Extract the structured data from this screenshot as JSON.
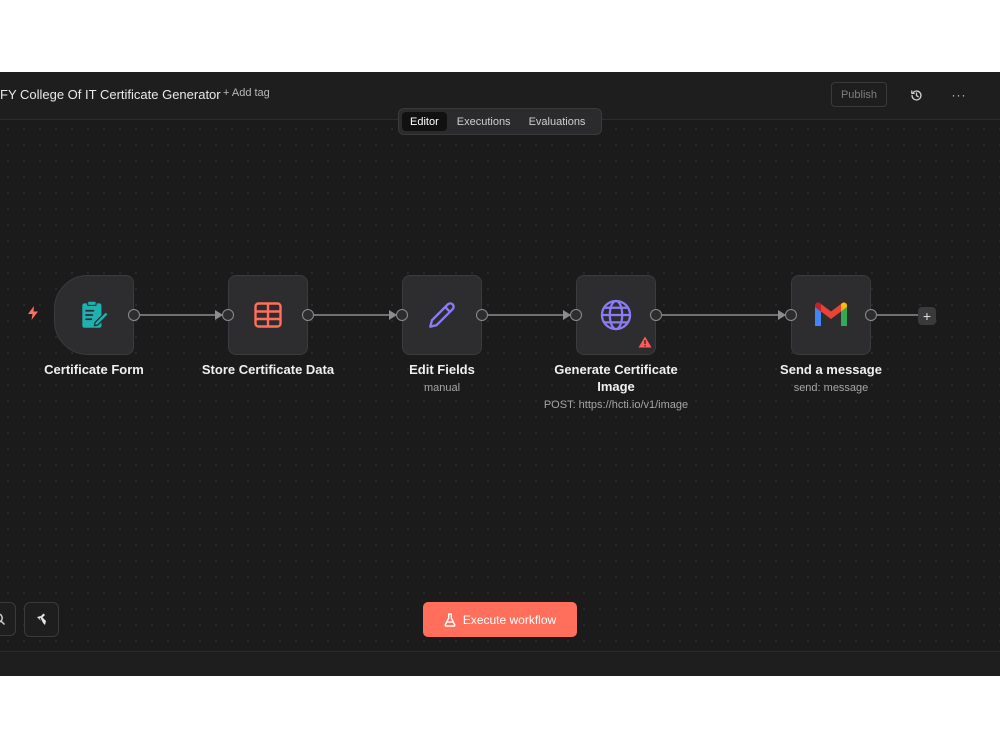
{
  "header": {
    "title": "FY College Of IT Certificate Generator",
    "add_tag": "+ Add tag",
    "publish": "Publish",
    "history_icon": "history-icon",
    "more": "···"
  },
  "tabs": [
    {
      "label": "Editor",
      "active": true
    },
    {
      "label": "Executions",
      "active": false
    },
    {
      "label": "Evaluations",
      "active": false
    }
  ],
  "nodes": [
    {
      "label": "Certificate Form",
      "subtitle": "",
      "icon": "form-icon",
      "color": "#1fb0b0"
    },
    {
      "label": "Store Certificate Data",
      "subtitle": "",
      "icon": "table-icon",
      "color": "#ff6f5c"
    },
    {
      "label": "Edit Fields",
      "subtitle": "manual",
      "icon": "pencil-icon",
      "color": "#8b7cf6"
    },
    {
      "label": "Generate Certificate Image",
      "subtitle": "POST: https://hcti.io/v1/image",
      "icon": "globe-icon",
      "color": "#8b7cf6",
      "warning": true
    },
    {
      "label": "Send a message",
      "subtitle": "send: message",
      "icon": "gmail-icon",
      "color": "#ea4335"
    }
  ],
  "toolbar": {
    "execute_label": "Execute workflow",
    "execute_color": "#ff6f5c"
  },
  "colors": {
    "canvas": "#1b1b1c",
    "node_bg": "#2d2d2f",
    "accent": "#ff6f5c",
    "warning": "#ff5b5b"
  }
}
